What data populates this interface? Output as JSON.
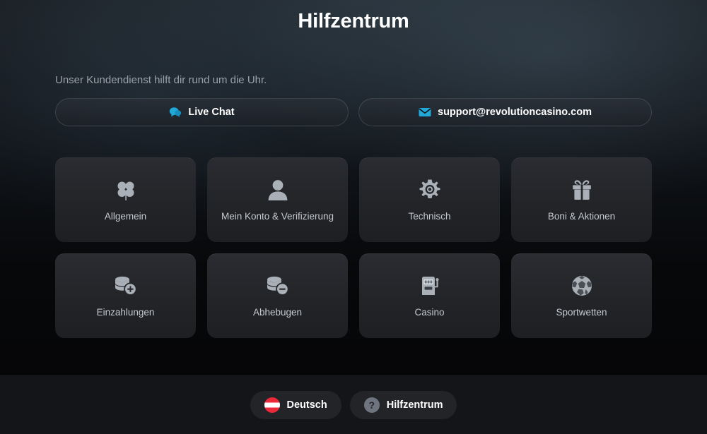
{
  "header": {
    "title": "Hilfzentrum"
  },
  "support": {
    "subtitle": "Unser Kundendienst hilft dir rund um die Uhr.",
    "live_chat_label": "Live Chat",
    "live_chat_icon": "chat-bubble-icon",
    "email_label": "support@revolutioncasino.com",
    "email_icon": "envelope-icon",
    "accent_color": "#1fa8d8"
  },
  "categories": [
    {
      "label": "Allgemein",
      "icon": "clover-icon"
    },
    {
      "label": "Mein Konto & Verifizierung",
      "icon": "user-icon"
    },
    {
      "label": "Technisch",
      "icon": "gear-icon"
    },
    {
      "label": "Boni & Aktionen",
      "icon": "gift-icon"
    },
    {
      "label": "Einzahlungen",
      "icon": "coins-plus-icon"
    },
    {
      "label": "Abhebugen",
      "icon": "coins-minus-icon"
    },
    {
      "label": "Casino",
      "icon": "slot-machine-icon"
    },
    {
      "label": "Sportwetten",
      "icon": "soccer-ball-icon"
    }
  ],
  "bottom_bar": {
    "language_label": "Deutsch",
    "language_icon": "austria-flag-icon",
    "help_label": "Hilfzentrum",
    "help_icon": "question-mark-icon"
  },
  "colors": {
    "accent": "#1fa8d8",
    "flag_red": "#ed2939",
    "card_bg": "#26282c",
    "text_muted": "#9aa1a9"
  }
}
